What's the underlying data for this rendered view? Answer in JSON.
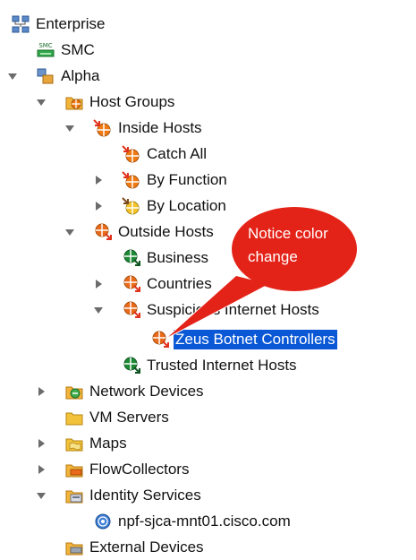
{
  "tree": {
    "enterprise": "Enterprise",
    "smc": "SMC",
    "alpha": "Alpha",
    "host_groups": "Host Groups",
    "inside_hosts": "Inside Hosts",
    "catch_all": "Catch All",
    "by_function": "By Function",
    "by_location": "By Location",
    "outside_hosts": "Outside Hosts",
    "business": "Business",
    "countries": "Countries",
    "suspicious": "Suspicious Internet Hosts",
    "zeus": "Zeus Botnet Controllers",
    "trusted": "Trusted Internet Hosts",
    "network_devices": "Network Devices",
    "vm_servers": "VM Servers",
    "maps": "Maps",
    "flow_collectors": "FlowCollectors",
    "identity_services": "Identity Services",
    "npf": "npf-sjca-mnt01.cisco.com",
    "external_devices": "External Devices"
  },
  "callout": {
    "line1": "Notice color",
    "line2": "change"
  },
  "icon_badge": "SMC",
  "colors": {
    "selection": "#0a58d6",
    "callout_fill": "#e42318",
    "inside_host_orange": "#f07a12",
    "outside_host_orange": "#e96a1b",
    "trusted_green": "#1e8a36"
  }
}
